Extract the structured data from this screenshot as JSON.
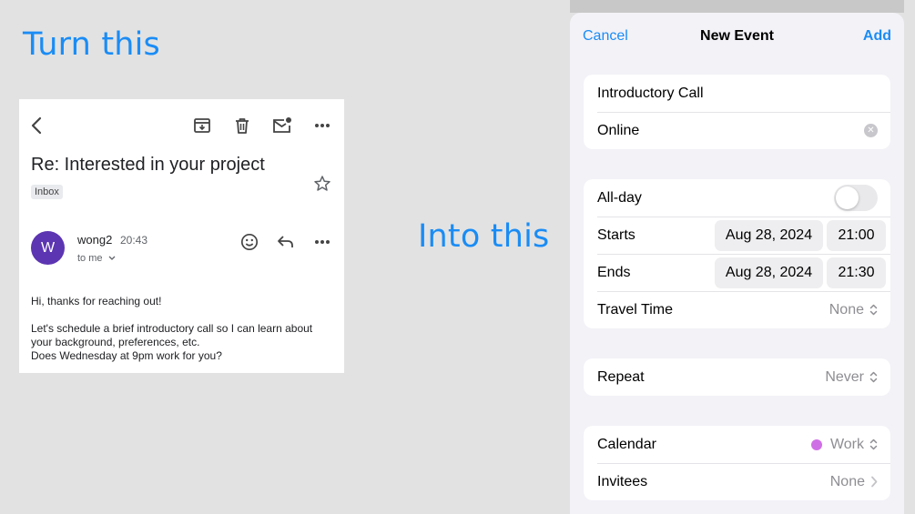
{
  "headlines": {
    "turn_this": "Turn this",
    "into_this": "Into this"
  },
  "email": {
    "subject": "Re: Interested in your project",
    "label_badge": "Inbox",
    "avatar_initial": "W",
    "sender": "wong2",
    "time": "20:43",
    "recipient": "to me",
    "body_lines": [
      "Hi, thanks for reaching out!",
      "Let's schedule a brief introductory call so I can learn about",
      "your background, preferences, etc.",
      "Does Wednesday at 9pm work for you?"
    ],
    "toolbar_icons": [
      "back-arrow-icon",
      "archive-icon",
      "trash-icon",
      "mark-unread-icon",
      "more-icon"
    ]
  },
  "event": {
    "nav": {
      "cancel": "Cancel",
      "title": "New Event",
      "add": "Add"
    },
    "title_value": "Introductory Call",
    "location_value": "Online",
    "all_day_label": "All-day",
    "all_day_on": false,
    "starts_label": "Starts",
    "starts_date": "Aug 28, 2024",
    "starts_time": "21:00",
    "ends_label": "Ends",
    "ends_date": "Aug 28, 2024",
    "ends_time": "21:30",
    "travel_label": "Travel Time",
    "travel_value": "None",
    "repeat_label": "Repeat",
    "repeat_value": "Never",
    "calendar_label": "Calendar",
    "calendar_value": "Work",
    "calendar_color": "#cf6fe6",
    "invitees_label": "Invitees",
    "invitees_value": "None"
  },
  "colors": {
    "accent_blue": "#1a8cf5",
    "avatar_purple": "#5c35b2"
  }
}
